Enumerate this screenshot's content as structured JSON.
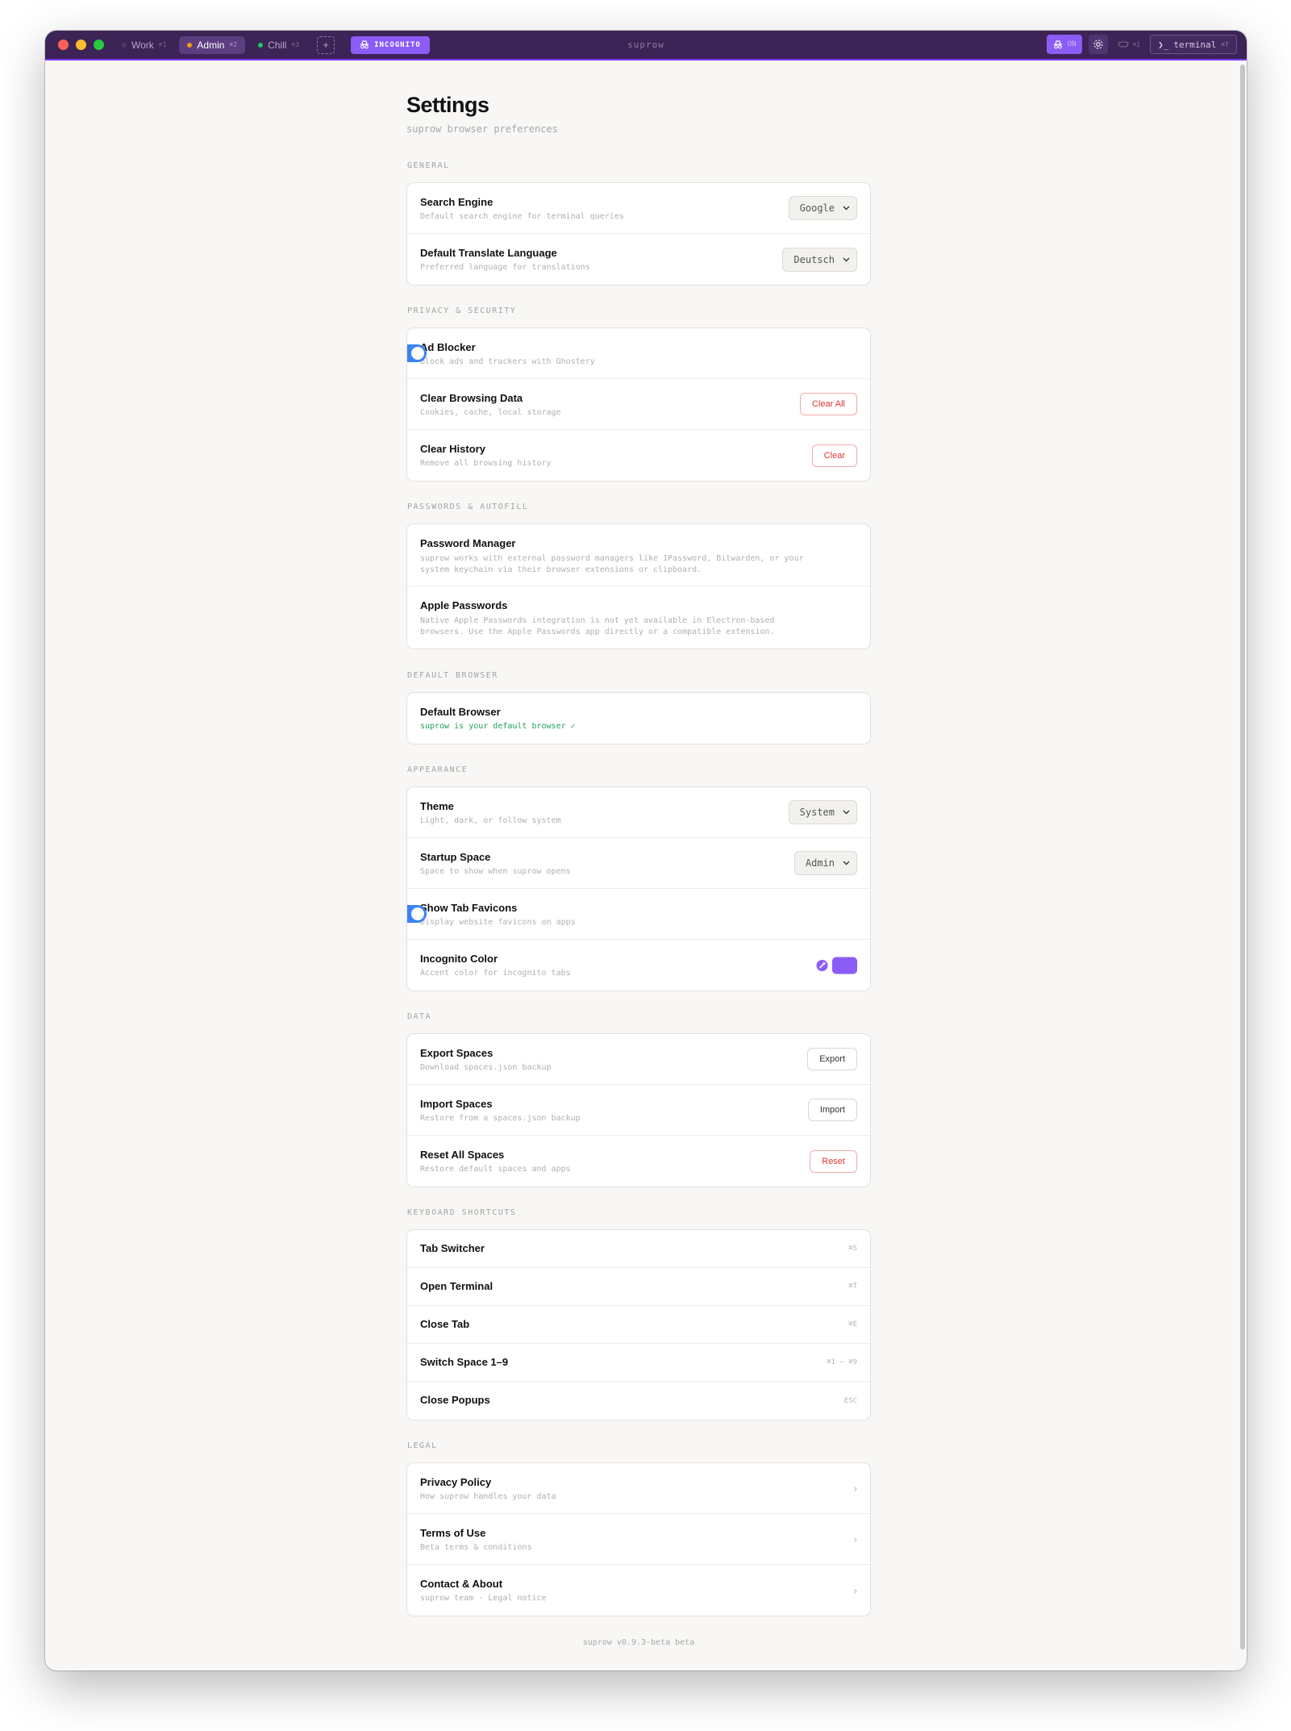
{
  "window": {
    "title": "suprow",
    "tabs": [
      {
        "label": "Work",
        "shortcut": "⌘1",
        "dot_color": "#4a3a66"
      },
      {
        "label": "Admin",
        "shortcut": "⌘2",
        "dot_color": "#f59e0b"
      },
      {
        "label": "Chill",
        "shortcut": "⌘3",
        "dot_color": "#22c55e"
      }
    ],
    "add_tab_label": "+",
    "incognito_label": "INCOGNITO",
    "incognito_toggle_state": "ON",
    "mask_shortcut": "⌘I",
    "terminal_label": "terminal",
    "terminal_shortcut": "⌘T"
  },
  "page": {
    "title": "Settings",
    "subtitle": "suprow browser preferences",
    "footer": "suprow v0.9.3-beta beta"
  },
  "general": {
    "heading": "GENERAL",
    "search_engine": {
      "title": "Search Engine",
      "desc": "Default search engine for terminal queries",
      "value": "Google"
    },
    "translate": {
      "title": "Default Translate Language",
      "desc": "Preferred language for translations",
      "value": "Deutsch"
    }
  },
  "privacy": {
    "heading": "PRIVACY & SECURITY",
    "ad_blocker": {
      "title": "Ad Blocker",
      "desc": "Block ads and trackers with Ghostery",
      "enabled": true
    },
    "clear_data": {
      "title": "Clear Browsing Data",
      "desc": "Cookies, cache, local storage",
      "button": "Clear All"
    },
    "clear_history": {
      "title": "Clear History",
      "desc": "Remove all browsing history",
      "button": "Clear"
    }
  },
  "passwords": {
    "heading": "PASSWORDS & AUTOFILL",
    "manager": {
      "title": "Password Manager",
      "desc": "suprow works with external password managers like 1Password, Bitwarden, or your\nsystem keychain via their browser extensions or clipboard."
    },
    "apple": {
      "title": "Apple Passwords",
      "desc": "Native Apple Passwords integration is not yet available in Electron-based\nbrowsers. Use the Apple Passwords app directly or a compatible extension."
    }
  },
  "default_browser": {
    "heading": "DEFAULT BROWSER",
    "title": "Default Browser",
    "status": "suprow is your default browser ✓"
  },
  "appearance": {
    "heading": "APPEARANCE",
    "theme": {
      "title": "Theme",
      "desc": "Light, dark, or follow system",
      "value": "System"
    },
    "startup": {
      "title": "Startup Space",
      "desc": "Space to show when suprow opens",
      "value": "Admin"
    },
    "favicons": {
      "title": "Show Tab Favicons",
      "desc": "Display website favicons on apps",
      "enabled": true
    },
    "incognito_color": {
      "title": "Incognito Color",
      "desc": "Accent color for incognito tabs",
      "color": "#8b5cf6"
    }
  },
  "data_section": {
    "heading": "DATA",
    "export": {
      "title": "Export Spaces",
      "desc": "Download spaces.json backup",
      "button": "Export"
    },
    "import": {
      "title": "Import Spaces",
      "desc": "Restore from a spaces.json backup",
      "button": "Import"
    },
    "reset": {
      "title": "Reset All Spaces",
      "desc": "Restore default spaces and apps",
      "button": "Reset"
    }
  },
  "shortcuts": {
    "heading": "KEYBOARD SHORTCUTS",
    "items": [
      {
        "title": "Tab Switcher",
        "keys": "⌘S"
      },
      {
        "title": "Open Terminal",
        "keys": "⌘T"
      },
      {
        "title": "Close Tab",
        "keys": "⌘E"
      },
      {
        "title": "Switch Space 1–9",
        "keys": "⌘1 – ⌘9"
      },
      {
        "title": "Close Popups",
        "keys": "ESC"
      }
    ]
  },
  "legal": {
    "heading": "LEGAL",
    "items": [
      {
        "title": "Privacy Policy",
        "desc": "How suprow handles your data"
      },
      {
        "title": "Terms of Use",
        "desc": "Beta terms & conditions"
      },
      {
        "title": "Contact & About",
        "desc": "suprow team · Legal notice"
      }
    ]
  },
  "icons": [
    "incognito-icon",
    "gear-icon",
    "mask-icon",
    "terminal-icon",
    "chevron-down-icon",
    "chevron-right-icon",
    "eyedropper-icon"
  ],
  "colors": {
    "accent": "#8b5cf6",
    "titlebar": "#3c2456",
    "toggle_on": "#3b82f6",
    "danger": "#e03535",
    "success": "#22a05a"
  }
}
